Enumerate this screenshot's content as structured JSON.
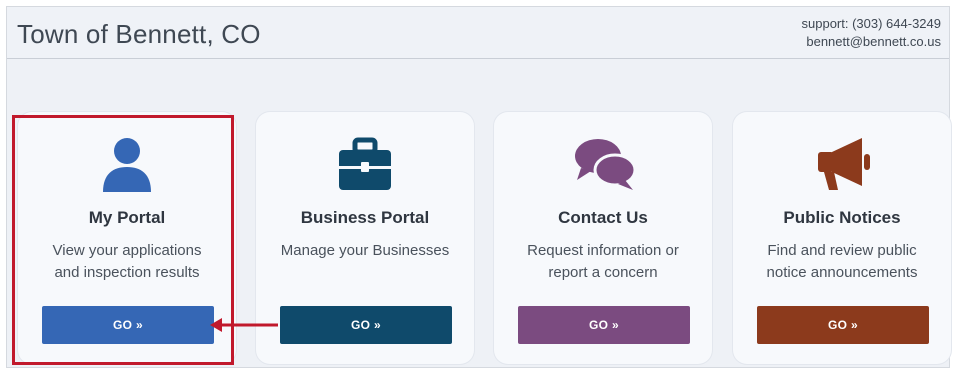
{
  "header": {
    "title": "Town of Bennett, CO",
    "support_line": "support: (303) 644-3249",
    "email": "bennett@bennett.co.us"
  },
  "cards": [
    {
      "title": "My Portal",
      "desc_line1": "View your applications",
      "desc_line2": "and inspection results",
      "button": "GO »",
      "icon": "person-icon",
      "color": "#3567b5"
    },
    {
      "title": "Business Portal",
      "desc_line1": "Manage your Businesses",
      "desc_line2": "",
      "button": "GO »",
      "icon": "briefcase-icon",
      "color": "#0f4a6b"
    },
    {
      "title": "Contact Us",
      "desc_line1": "Request information or",
      "desc_line2": "report a concern",
      "button": "GO »",
      "icon": "chat-bubbles-icon",
      "color": "#7b4b80"
    },
    {
      "title": "Public Notices",
      "desc_line1": "Find and review public",
      "desc_line2": "notice announcements",
      "button": "GO »",
      "icon": "megaphone-icon",
      "color": "#8c3a1c"
    }
  ],
  "annotation": {
    "highlight_color": "#c1192c"
  }
}
